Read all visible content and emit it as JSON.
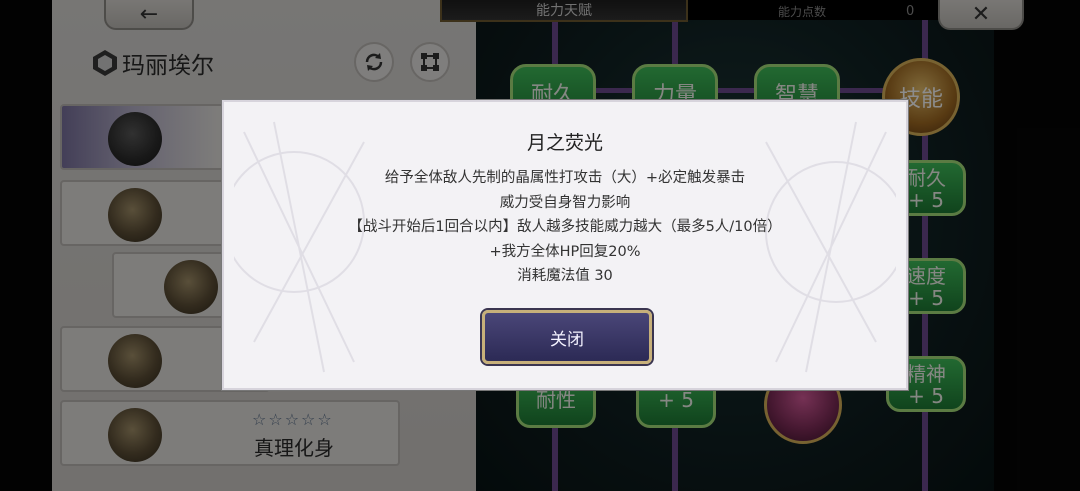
{
  "top_bar": {
    "title": "能力天赋",
    "points_label": "能力点数",
    "points_value": "0"
  },
  "character": {
    "name": "玛丽埃尔"
  },
  "skill_cards": [
    {
      "stars": "☆☆☆☆☆",
      "title": "真理化身"
    }
  ],
  "tree": {
    "top_nodes": [
      "耐久",
      "力量",
      "智慧",
      "技能"
    ],
    "right_nodes": [
      {
        "line1": "耐久",
        "line2": "+ 5"
      },
      {
        "line1": "速度",
        "line2": "+ 5"
      },
      {
        "line1": "精神",
        "line2": "+ 5"
      }
    ],
    "bottom_nodes": [
      {
        "label": "耐性"
      },
      {
        "label": "+ 5"
      }
    ]
  },
  "modal": {
    "title": "月之荧光",
    "lines": [
      "给予全体敌人先制的晶属性打攻击（大）+必定触发暴击",
      "威力受自身智力影响",
      "【战斗开始后1回合以内】敌人越多技能威力越大（最多5人/10倍）",
      "+我方全体HP回复20%",
      "消耗魔法值 30"
    ],
    "close_label": "关闭"
  }
}
